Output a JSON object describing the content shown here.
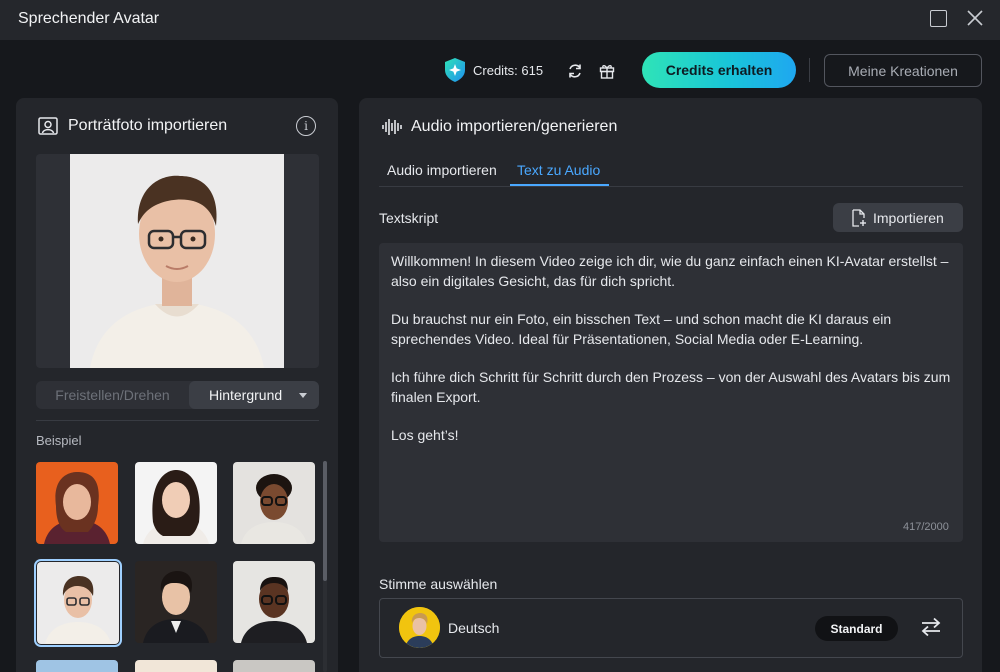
{
  "window": {
    "title": "Sprechender Avatar",
    "controls": [
      "maximize-icon",
      "close-icon"
    ]
  },
  "topbar": {
    "credits_label": "Credits: 615",
    "credits_icon": "credits-shield-icon",
    "refresh_icon": "refresh-icon",
    "gift_icon": "gift-icon",
    "get_credits_button": "Credits erhalten",
    "my_creations_button": "Meine Kreationen",
    "accent_gradient": [
      "#2fe3b7",
      "#19c6d8",
      "#1fa7f0"
    ]
  },
  "left_panel": {
    "title": "Porträtfoto importieren",
    "title_icon": "portrait-icon",
    "info_icon": "info-icon",
    "segments": {
      "left": "Freistellen/Drehen",
      "right": "Hintergrund",
      "active": "right"
    },
    "examples_label": "Beispiel",
    "examples": [
      {
        "name": "avatar-woman-orange-bg"
      },
      {
        "name": "avatar-woman-asian"
      },
      {
        "name": "avatar-man-glasses-1"
      },
      {
        "name": "avatar-man-glasses-selected",
        "selected": true
      },
      {
        "name": "avatar-man-suit"
      },
      {
        "name": "avatar-man-glasses-2"
      }
    ]
  },
  "right_panel": {
    "title": "Audio importieren/generieren",
    "title_icon": "audio-wave-icon",
    "tabs": [
      {
        "label": "Audio importieren",
        "active": false
      },
      {
        "label": "Text zu Audio",
        "active": true
      }
    ],
    "script_label": "Textskript",
    "import_button": "Importieren",
    "script_paragraphs": [
      "Willkommen! In diesem Video zeige ich dir, wie du ganz einfach einen KI-Avatar erstellst – also ein digitales Gesicht, das für dich spricht.",
      "Du brauchst nur ein Foto, ein bisschen Text – und schon macht die KI daraus ein sprechendes Video. Ideal für Präsentationen, Social Media oder E-Learning.",
      "Ich führe dich Schritt für Schritt durch den Prozess – von der Auswahl des Avatars bis zum finalen Export.",
      "Los geht’s!"
    ],
    "char_counter": "417/2000",
    "voice_label": "Stimme auswählen",
    "voice": {
      "name": "Deutsch",
      "badge": "Standard",
      "swap_icon": "swap-icon"
    }
  }
}
